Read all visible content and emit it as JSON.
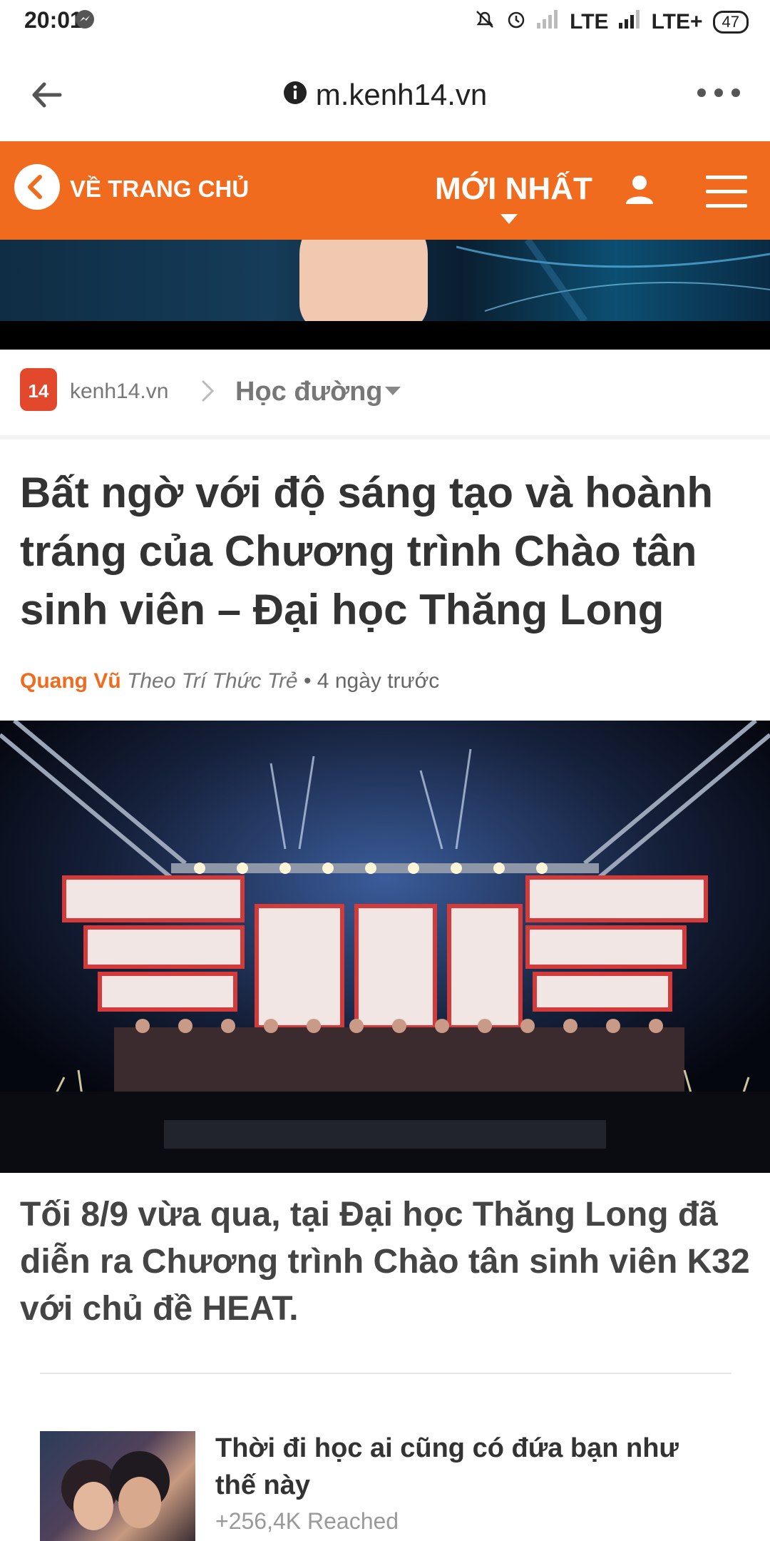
{
  "status_bar": {
    "time": "20:01",
    "network1": "LTE",
    "network2": "LTE+",
    "battery": "47"
  },
  "browser": {
    "url": "m.kenh14.vn"
  },
  "nav": {
    "home_label": "VỀ TRANG CHỦ",
    "latest_label": "MỚI NHẤT",
    "accent_color": "#f06b1e"
  },
  "breadcrumb": {
    "logo_text": "14",
    "site": "kenh14.vn",
    "category": "Học đường"
  },
  "article": {
    "title": "Bất ngờ với độ sáng tạo và hoành tráng của Chương trình Chào tân sinh viên – Đại học Thăng Long",
    "author": "Quang Vũ",
    "source": "Theo Trí Thức Trẻ",
    "time": "• 4 ngày trước",
    "lead": "Tối 8/9 vừa qua, tại Đại học Thăng Long đã diễn ra Chương trình Chào tân sinh viên K32 với chủ đề HEAT."
  },
  "related": {
    "title": "Thời đi học ai cũng có đứa bạn như thế này",
    "reach": "+256,4K Reached"
  }
}
